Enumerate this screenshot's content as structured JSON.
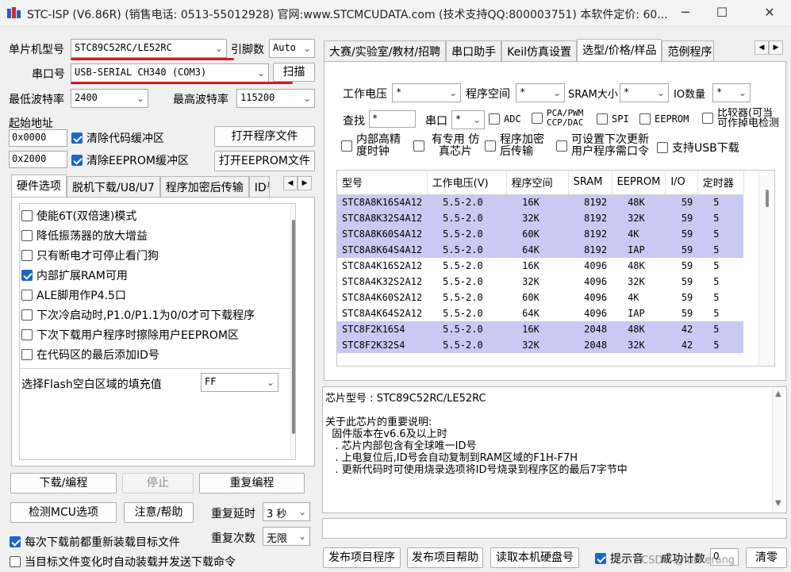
{
  "window": {
    "title": "STC-ISP (V6.86R) (销售电话: 0513-55012928) 官网:www.STCMCUDATA.com  (技术支持QQ:800003751) 本软件定价: 60...",
    "min_glyph": "─",
    "max_glyph": "☐",
    "close_glyph": "✕"
  },
  "left": {
    "mcu_label": "单片机型号",
    "mcu_value": "STC89C52RC/LE52RC",
    "pin_label": "引脚数",
    "pin_value": "Auto",
    "port_label": "串口号",
    "port_value": "USB-SERIAL CH340 (COM3)",
    "scan_button": "扫描",
    "min_baud_label": "最低波特率",
    "min_baud_value": "2400",
    "max_baud_label": "最高波特率",
    "max_baud_value": "115200",
    "start_addr_label": "起始地址",
    "addr1": "0x0000",
    "clear_code_label": "清除代码缓冲区",
    "open_prog_button": "打开程序文件",
    "addr2": "0x2000",
    "clear_eeprom_label": "清除EEPROM缓冲区",
    "open_eeprom_button": "打开EEPROM文件",
    "tabs": [
      "硬件选项",
      "脱机下载/U8/U7",
      "程序加密后传输",
      "ID号"
    ],
    "options": [
      {
        "label": "使能6T(双倍速)模式",
        "checked": false
      },
      {
        "label": "降低振荡器的放大增益",
        "checked": false
      },
      {
        "label": "只有断电才可停止看门狗",
        "checked": false
      },
      {
        "label": "内部扩展RAM可用",
        "checked": true
      },
      {
        "label": "ALE脚用作P4.5口",
        "checked": false
      },
      {
        "label": "下次冷启动时,P1.0/P1.1为0/0才可下载程序",
        "checked": false
      },
      {
        "label": "下次下载用户程序时擦除用户EEPROM区",
        "checked": false
      },
      {
        "label": "在代码区的最后添加ID号",
        "checked": false
      }
    ],
    "fill_label": "选择Flash空白区域的填充值",
    "fill_value": "FF",
    "download_button": "下载/编程",
    "stop_button": "停止",
    "reprogram_button": "重复编程",
    "detect_button": "检测MCU选项",
    "help_button": "注意/帮助",
    "repeat_delay_label": "重复延时",
    "repeat_delay_value": "3 秒",
    "repeat_count_label": "重复次数",
    "repeat_count_value": "无限",
    "reload_label": "每次下载前都重新装载目标文件",
    "reload_checked": true,
    "auto_send_label": "当目标文件变化时自动装载并发送下载命令",
    "auto_send_checked": false
  },
  "right": {
    "tabs": [
      "大赛/实验室/教材/招聘",
      "串口助手",
      "Keil仿真设置",
      "选型/价格/样品",
      "范例程序"
    ],
    "filter": {
      "voltage_label": "工作电压",
      "voltage_value": "*",
      "progspace_label": "程序空间",
      "progspace_value": "*",
      "sram_label": "SRAM大小",
      "sram_value": "*",
      "io_label": "IO数量",
      "io_value": "*",
      "search_label": "查找",
      "search_value": "*",
      "uart_label": "串口",
      "uart_value": "*",
      "adc_label": "ADC",
      "pca_label": "PCA/PWM CCP/DAC",
      "spi_label": "SPI",
      "eeprom_label": "EEPROM",
      "comparator_label": "比较器(可当可作掉电检测",
      "highprec_label": "内部高精 度时钟",
      "emulation_label": "有专用 仿真芯片",
      "encrypt_label": "程序加密 后传输",
      "setnext_label": "可设置下次更新 用户程序需口令",
      "usb_label": "支持USB下载"
    },
    "table": {
      "headers": [
        "型号",
        "工作电压(V)",
        "程序空间",
        "SRAM",
        "EEPROM",
        "I/O",
        "定时器"
      ],
      "rows": [
        {
          "cells": [
            "STC8A8K16S4A12",
            "5.5-2.0",
            "16K",
            "8192",
            "48K",
            "59",
            "5"
          ],
          "hl": true
        },
        {
          "cells": [
            "STC8A8K32S4A12",
            "5.5-2.0",
            "32K",
            "8192",
            "32K",
            "59",
            "5"
          ],
          "hl": true
        },
        {
          "cells": [
            "STC8A8K60S4A12",
            "5.5-2.0",
            "60K",
            "8192",
            "4K",
            "59",
            "5"
          ],
          "hl": true
        },
        {
          "cells": [
            "STC8A8K64S4A12",
            "5.5-2.0",
            "64K",
            "8192",
            "IAP",
            "59",
            "5"
          ],
          "hl": true
        },
        {
          "cells": [
            "STC8A4K16S2A12",
            "5.5-2.0",
            "16K",
            "4096",
            "48K",
            "59",
            "5"
          ],
          "hl": false
        },
        {
          "cells": [
            "STC8A4K32S2A12",
            "5.5-2.0",
            "32K",
            "4096",
            "32K",
            "59",
            "5"
          ],
          "hl": false
        },
        {
          "cells": [
            "STC8A4K60S2A12",
            "5.5-2.0",
            "60K",
            "4096",
            "4K",
            "59",
            "5"
          ],
          "hl": false
        },
        {
          "cells": [
            "STC8A4K64S2A12",
            "5.5-2.0",
            "64K",
            "4096",
            "IAP",
            "59",
            "5"
          ],
          "hl": false
        },
        {
          "cells": [
            "STC8F2K16S4",
            "5.5-2.0",
            "16K",
            "2048",
            "48K",
            "42",
            "5"
          ],
          "hl": true
        },
        {
          "cells": [
            "STC8F2K32S4",
            "5.5-2.0",
            "32K",
            "2048",
            "32K",
            "42",
            "5"
          ],
          "hl": true
        }
      ]
    },
    "info": {
      "chip_line": "芯片型号 : STC89C52RC/LE52RC",
      "lines": [
        "关于此芯片的重要说明:",
        "  固件版本在v6.6及以上时",
        "   . 芯片内部包含有全球唯一ID号",
        "   . 上电复位后,ID号会自动复制到RAM区域的F1H-F7H",
        "   . 更新代码时可使用烧录选项将ID号烧录到程序区的最后7字节中"
      ]
    },
    "bottom": {
      "publish_button": "发布项目程序",
      "publish_help_button": "发布项目帮助",
      "read_disk_button": "读取本机硬盘号",
      "prompt_label": "提示音",
      "prompt_checked": true,
      "success_label": "成功计数",
      "success_value": "0",
      "clear_button": "清零"
    },
    "watermark": "CSDN @luckerang"
  }
}
